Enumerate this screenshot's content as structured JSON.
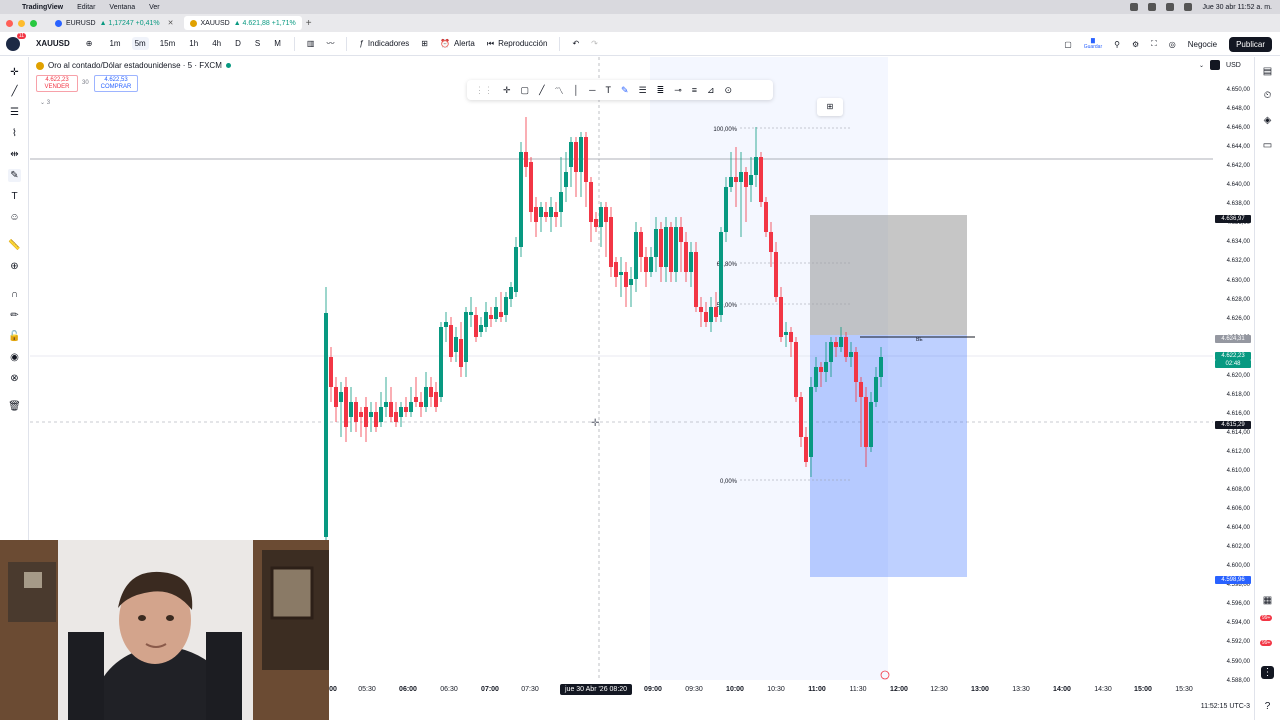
{
  "menubar": {
    "app_name": "TradingView",
    "items": [
      "Editar",
      "Ventana",
      "Ver"
    ],
    "clock": "Jue 30 abr  11:52 a. m."
  },
  "tabs": [
    {
      "symbol": "EURUSD",
      "change": "▲ 1,17247 +0,41%"
    },
    {
      "symbol": "XAUUSD",
      "change": "▲ 4.621,88 +1,71%"
    }
  ],
  "toolbar": {
    "symbol": "XAUUSD",
    "timeframes": [
      "1m",
      "5m",
      "15m",
      "1h",
      "4h",
      "D",
      "S",
      "M"
    ],
    "selected_timeframe": "5m",
    "indicators_label": "Indicadores",
    "alert_label": "Alerta",
    "replay_label": "Reproducción",
    "save_label": "Guardar",
    "trade_label": "Negocie",
    "publish_label": "Publicar",
    "avatar_badge": "11"
  },
  "legend": {
    "title": "Oro al contado/Dólar estadounidense · 5 · FXCM",
    "sell_price": "4.622,23",
    "sell_label": "VENDER",
    "buy_price": "4.622,53",
    "buy_label": "COMPRAR",
    "spread": "30",
    "indicator_count": "3"
  },
  "price_scale": {
    "currency": "USD",
    "ticks": [
      "4.650,00",
      "4.648,00",
      "4.646,00",
      "4.644,00",
      "4.642,00",
      "4.640,00",
      "4.638,00",
      "4.636,00",
      "4.634,00",
      "4.632,00",
      "4.630,00",
      "4.628,00",
      "4.626,00",
      "4.624,00",
      "4.622,00",
      "4.620,00",
      "4.618,00",
      "4.616,00",
      "4.614,00",
      "4.612,00",
      "4.610,00",
      "4.608,00",
      "4.606,00",
      "4.604,00",
      "4.602,00",
      "4.600,00",
      "4.598,00",
      "4.596,00",
      "4.594,00",
      "4.592,00",
      "4.590,00",
      "4.588,00"
    ],
    "labels": [
      {
        "text": "4.636,97",
        "color": "#131722"
      },
      {
        "text": "4.624,31",
        "color": "#9598a1"
      },
      {
        "text": "4.622,23",
        "color": "#089981"
      },
      {
        "text": "02:48",
        "color": "#089981"
      },
      {
        "text": "4.615,29",
        "color": "#131722"
      },
      {
        "text": "4.598,96",
        "color": "#2962ff"
      }
    ]
  },
  "time_axis": {
    "labels": [
      "05:30",
      "06:00",
      "06:30",
      "07:00",
      "07:30",
      "09:00",
      "09:30",
      "10:00",
      "10:30",
      "11:00",
      "11:30",
      "12:00",
      "12:30",
      "13:00",
      "13:30",
      "14:00",
      "14:30",
      "15:00",
      "15:30"
    ],
    "cursor_label": "jue 30 Abr '26   08:20",
    "first_partial": "00"
  },
  "fib_levels": [
    "100,00%",
    "61,80%",
    "50,00%",
    "0,00%"
  ],
  "position_label": "BE",
  "footer_time": "11:52:15 UTC-3",
  "colors": {
    "up": "#089981",
    "down": "#f23645",
    "accent": "#2962ff"
  },
  "icons": [
    "cross-icon",
    "trendline-icon",
    "fib-icon",
    "pattern-icon",
    "measure-icon",
    "brush-icon",
    "text-icon",
    "emoji-icon",
    "ruler-icon",
    "zoom-icon",
    "magnet-icon",
    "lock-icon",
    "eye-icon",
    "trash-icon"
  ]
}
